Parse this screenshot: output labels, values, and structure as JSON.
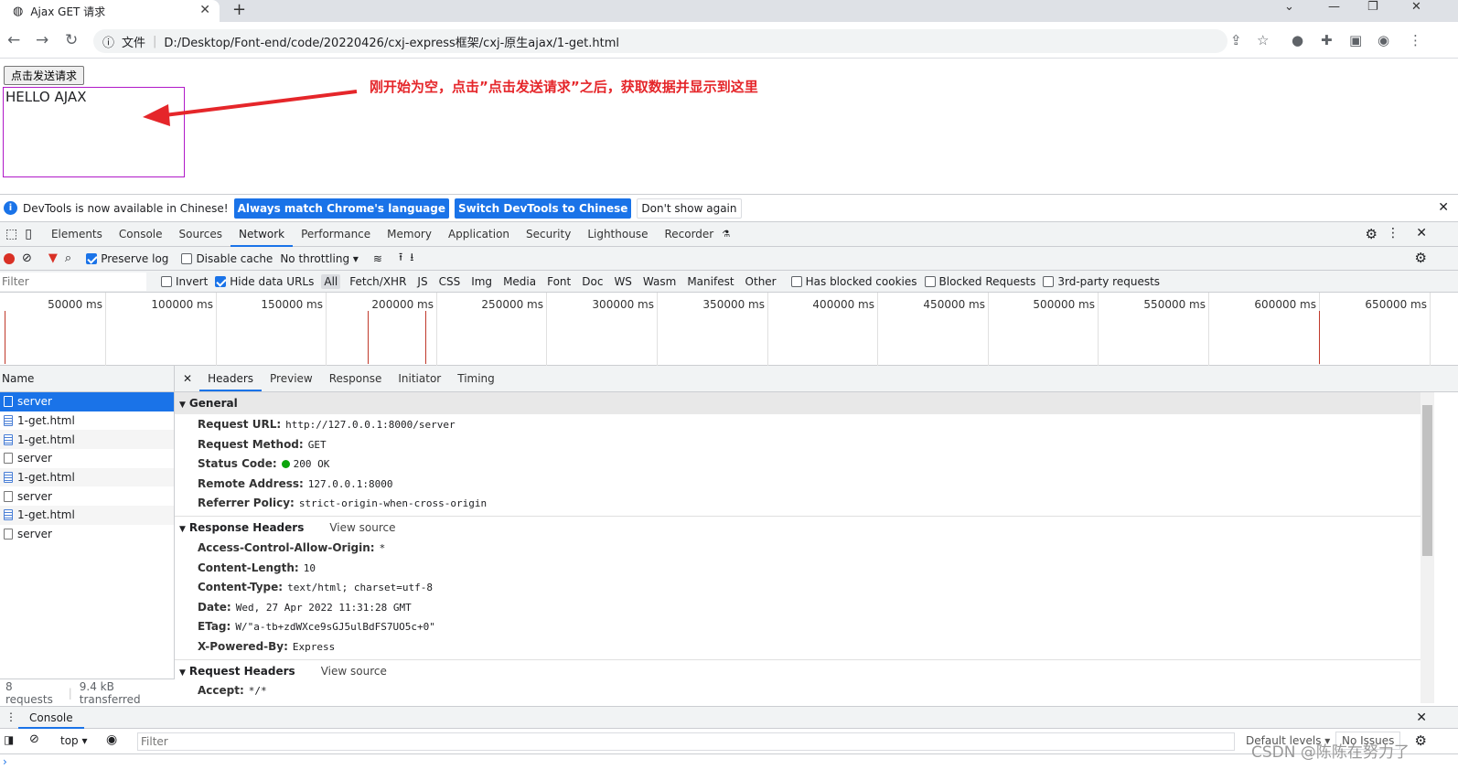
{
  "browser": {
    "tab_title": "Ajax GET 请求",
    "file_label": "文件",
    "url": "D:/Desktop/Font-end/code/20220426/cxj-express框架/cxj-原生ajax/1-get.html"
  },
  "page": {
    "button_label": "点击发送请求",
    "result_text": "HELLO AJAX",
    "annotation": "刚开始为空，点击”点击发送请求”之后，获取数据并显示到这里",
    "annotation_color": "#e5262a"
  },
  "devtools": {
    "infobar": {
      "message": "DevTools is now available in Chinese!",
      "btn_match": "Always match Chrome's language",
      "btn_switch": "Switch DevTools to Chinese",
      "btn_dont_show": "Don't show again"
    },
    "tabs": [
      "Elements",
      "Console",
      "Sources",
      "Network",
      "Performance",
      "Memory",
      "Application",
      "Security",
      "Lighthouse",
      "Recorder"
    ],
    "network_toolbar": {
      "preserve_log": "Preserve log",
      "disable_cache": "Disable cache",
      "throttling": "No throttling"
    },
    "filter": {
      "placeholder": "Filter",
      "invert": "Invert",
      "hide_data_urls": "Hide data URLs",
      "types": [
        "All",
        "Fetch/XHR",
        "JS",
        "CSS",
        "Img",
        "Media",
        "Font",
        "Doc",
        "WS",
        "Wasm",
        "Manifest",
        "Other"
      ],
      "has_blocked_cookies": "Has blocked cookies",
      "blocked_requests": "Blocked Requests",
      "third_party": "3rd-party requests"
    },
    "timeline_ticks": [
      "50000 ms",
      "100000 ms",
      "150000 ms",
      "200000 ms",
      "250000 ms",
      "300000 ms",
      "350000 ms",
      "400000 ms",
      "450000 ms",
      "500000 ms",
      "550000 ms",
      "600000 ms",
      "650000 ms"
    ],
    "requests_header": "Name",
    "requests": [
      "server",
      "1-get.html",
      "1-get.html",
      "server",
      "1-get.html",
      "server",
      "1-get.html",
      "server"
    ],
    "footer": {
      "count": "8 requests",
      "transferred": "9.4 kB transferred"
    },
    "detail_tabs": [
      "Headers",
      "Preview",
      "Response",
      "Initiator",
      "Timing"
    ],
    "general": {
      "title": "General",
      "rows": [
        {
          "k": "Request URL:",
          "v": "http://127.0.0.1:8000/server"
        },
        {
          "k": "Request Method:",
          "v": "GET"
        },
        {
          "k": "Status Code:",
          "v": "200 OK"
        },
        {
          "k": "Remote Address:",
          "v": "127.0.0.1:8000"
        },
        {
          "k": "Referrer Policy:",
          "v": "strict-origin-when-cross-origin"
        }
      ]
    },
    "response_headers": {
      "title": "Response Headers",
      "view_source": "View source",
      "rows": [
        {
          "k": "Access-Control-Allow-Origin:",
          "v": "*"
        },
        {
          "k": "Content-Length:",
          "v": "10"
        },
        {
          "k": "Content-Type:",
          "v": "text/html; charset=utf-8"
        },
        {
          "k": "Date:",
          "v": "Wed, 27 Apr 2022 11:31:28 GMT"
        },
        {
          "k": "ETag:",
          "v": "W/\"a-tb+zdWXce9sGJ5ulBdFS7UO5c+0\""
        },
        {
          "k": "X-Powered-By:",
          "v": "Express"
        }
      ]
    },
    "request_headers": {
      "title": "Request Headers",
      "view_source": "View source",
      "rows": [
        {
          "k": "Accept:",
          "v": "*/*"
        }
      ]
    },
    "console": {
      "tab": "Console",
      "context": "top",
      "filter_placeholder": "Filter",
      "levels": "Default levels",
      "issues": "No Issues"
    },
    "accent_color": "#1a73e8"
  },
  "watermark": "CSDN @陈陈在努力了"
}
